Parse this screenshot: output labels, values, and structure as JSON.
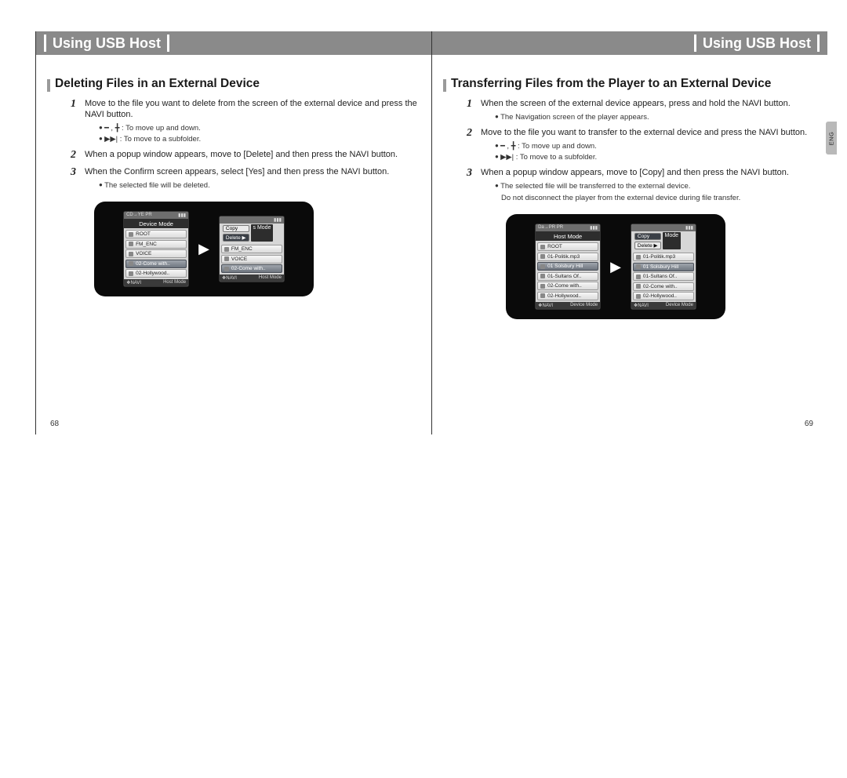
{
  "left": {
    "header": "Using USB Host",
    "section": "Deleting Files in an External Device",
    "steps": [
      {
        "num": "1",
        "text": "Move to the file you want to delete from the screen of the external device and press the NAVI button.",
        "bullets": [
          "━ , ╋ : To move up and down.",
          "▶▶| : To move to a subfolder."
        ]
      },
      {
        "num": "2",
        "text": "When a popup window appears, move to [Delete] and then press the NAVI button."
      },
      {
        "num": "3",
        "text": "When the Confirm screen appears, select  [Yes] and then press the NAVI button.",
        "bullets": [
          "The selected file will be deleted."
        ]
      }
    ],
    "page_num": "68",
    "screens": {
      "a": {
        "top_left": "CD→YE PR",
        "title": "Device Mode",
        "items": [
          "ROOT",
          "FM_ENC",
          "VOICE",
          "02-Come with..",
          "02-Hollywood.."
        ],
        "sel": 3,
        "footer_right": "Host Mode"
      },
      "b": {
        "menu": [
          "Copy",
          "Delete ▶"
        ],
        "menu_trail": "s Mode",
        "items": [
          "FM_ENC",
          "VOICE",
          "02-Come with.."
        ],
        "sel": 2,
        "footer_right": "Host Mode"
      }
    }
  },
  "right": {
    "header": "Using USB Host",
    "section": "Transferring Files from the Player to an External Device",
    "steps": [
      {
        "num": "1",
        "text": "When the screen of the external device appears, press and hold the NAVI button.",
        "bullets": [
          "The Navigation screen of the player appears."
        ]
      },
      {
        "num": "2",
        "text": "Move to the file you want to transfer to the external device and press the NAVI button.",
        "bullets": [
          "━ , ╋ : To move up and down.",
          "▶▶| : To move to a subfolder."
        ]
      },
      {
        "num": "3",
        "text": "When a popup window appears, move to [Copy] and then press the NAVI button.",
        "bullets": [
          "The selected file will be transferred to the external device.",
          "Do not disconnect the player from the external device during file transfer."
        ],
        "flat_second": true
      }
    ],
    "page_num": "69",
    "lang_tab": "ENG",
    "screens": {
      "a": {
        "top_left": "Da→PR PR",
        "title": "Host Mode",
        "items": [
          "ROOT",
          "01-Politik.mp3",
          "01 Solsbury Hill",
          "01-Sultans Of..",
          "02-Come with..",
          "02-Hollywood.."
        ],
        "sel": 2,
        "footer_right": "Device Mode"
      },
      "b": {
        "menu": [
          "Copy",
          "Delete ▶"
        ],
        "menu_trail": "Mode",
        "items": [
          "01-Politik.mp3",
          "01 Solsbury Hill",
          "01-Sultans Of..",
          "02-Come with..",
          "02-Hollywood.."
        ],
        "sel": 1,
        "footer_right": "Device Mode"
      }
    }
  }
}
